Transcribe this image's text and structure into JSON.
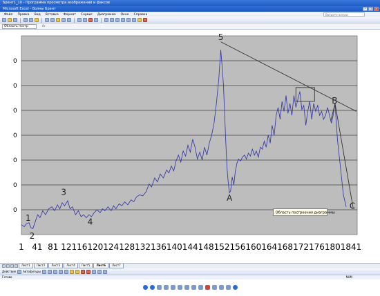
{
  "viewer": {
    "title": "Брент1_10 - Программа просмотра изображений и факсов"
  },
  "excel": {
    "title": "Microsoft Excel - Волны Брент"
  },
  "menu": [
    "Файл",
    "Правка",
    "Вид",
    "Вставка",
    "Формат",
    "Сервис",
    "Диаграмма",
    "Окно",
    "Справка"
  ],
  "help_placeholder": "Введите вопрос",
  "name_box": "Область постр",
  "fx_label": "fx",
  "sheet_tabs": [
    "Лист1",
    "Лист2",
    "Лист3",
    "Лист4",
    "Лист5",
    "Лист6",
    "Лист7"
  ],
  "active_tab": "Лист6",
  "drawbar": {
    "actions": "Действия",
    "autoshapes": "Автофигуры"
  },
  "status": {
    "ready": "Готово",
    "num": "NUM"
  },
  "tooltip": "Область построения диаграммы",
  "colors": {
    "series": "#3c3ca8",
    "plot_bg": "#bdbdbd",
    "title_bar": "#2f6fd8"
  },
  "chart_data": {
    "type": "line",
    "x_ticks": [
      "1",
      "41",
      "81",
      "121",
      "161",
      "201",
      "241",
      "281",
      "321",
      "361",
      "401",
      "441",
      "481",
      "521",
      "561",
      "601",
      "641",
      "681",
      "721",
      "761",
      "801",
      "841"
    ],
    "xlim": [
      1,
      850
    ],
    "grid": true,
    "wave_labels": [
      {
        "text": "1",
        "x": 18,
        "level": 0.07
      },
      {
        "text": "2",
        "x": 28,
        "level": -0.02
      },
      {
        "text": "3",
        "x": 108,
        "level": 0.2
      },
      {
        "text": "4",
        "x": 175,
        "level": 0.05
      },
      {
        "text": "5",
        "x": 505,
        "level": 0.98
      },
      {
        "text": "A",
        "x": 527,
        "level": 0.17
      },
      {
        "text": "B",
        "x": 793,
        "level": 0.66
      },
      {
        "text": "C",
        "x": 838,
        "level": 0.13
      }
    ],
    "series": [
      {
        "points": [
          [
            1,
            0.05
          ],
          [
            8,
            0.04
          ],
          [
            14,
            0.055
          ],
          [
            20,
            0.06
          ],
          [
            25,
            0.035
          ],
          [
            30,
            0.03
          ],
          [
            36,
            0.065
          ],
          [
            42,
            0.1
          ],
          [
            48,
            0.085
          ],
          [
            55,
            0.12
          ],
          [
            62,
            0.1
          ],
          [
            70,
            0.13
          ],
          [
            78,
            0.14
          ],
          [
            85,
            0.12
          ],
          [
            92,
            0.15
          ],
          [
            98,
            0.13
          ],
          [
            104,
            0.16
          ],
          [
            110,
            0.145
          ],
          [
            118,
            0.17
          ],
          [
            124,
            0.13
          ],
          [
            130,
            0.14
          ],
          [
            138,
            0.1
          ],
          [
            145,
            0.12
          ],
          [
            152,
            0.09
          ],
          [
            158,
            0.1
          ],
          [
            165,
            0.085
          ],
          [
            172,
            0.1
          ],
          [
            178,
            0.09
          ],
          [
            185,
            0.11
          ],
          [
            192,
            0.125
          ],
          [
            200,
            0.11
          ],
          [
            206,
            0.13
          ],
          [
            212,
            0.12
          ],
          [
            220,
            0.14
          ],
          [
            228,
            0.12
          ],
          [
            234,
            0.145
          ],
          [
            240,
            0.13
          ],
          [
            248,
            0.155
          ],
          [
            255,
            0.145
          ],
          [
            262,
            0.165
          ],
          [
            270,
            0.15
          ],
          [
            278,
            0.175
          ],
          [
            285,
            0.165
          ],
          [
            292,
            0.19
          ],
          [
            300,
            0.2
          ],
          [
            308,
            0.195
          ],
          [
            316,
            0.215
          ],
          [
            324,
            0.255
          ],
          [
            330,
            0.24
          ],
          [
            338,
            0.285
          ],
          [
            345,
            0.265
          ],
          [
            352,
            0.305
          ],
          [
            360,
            0.285
          ],
          [
            368,
            0.325
          ],
          [
            374,
            0.31
          ],
          [
            380,
            0.345
          ],
          [
            386,
            0.32
          ],
          [
            392,
            0.37
          ],
          [
            398,
            0.4
          ],
          [
            404,
            0.365
          ],
          [
            410,
            0.42
          ],
          [
            416,
            0.395
          ],
          [
            422,
            0.45
          ],
          [
            428,
            0.415
          ],
          [
            434,
            0.48
          ],
          [
            440,
            0.44
          ],
          [
            446,
            0.38
          ],
          [
            452,
            0.415
          ],
          [
            458,
            0.375
          ],
          [
            464,
            0.44
          ],
          [
            470,
            0.4
          ],
          [
            476,
            0.46
          ],
          [
            482,
            0.5
          ],
          [
            488,
            0.56
          ],
          [
            494,
            0.66
          ],
          [
            500,
            0.78
          ],
          [
            505,
            0.93
          ],
          [
            508,
            0.86
          ],
          [
            512,
            0.75
          ],
          [
            515,
            0.6
          ],
          [
            518,
            0.45
          ],
          [
            521,
            0.33
          ],
          [
            524,
            0.26
          ],
          [
            527,
            0.21
          ],
          [
            530,
            0.22
          ],
          [
            534,
            0.29
          ],
          [
            538,
            0.25
          ],
          [
            542,
            0.32
          ],
          [
            546,
            0.36
          ],
          [
            550,
            0.38
          ],
          [
            555,
            0.37
          ],
          [
            560,
            0.39
          ],
          [
            565,
            0.4
          ],
          [
            570,
            0.38
          ],
          [
            575,
            0.41
          ],
          [
            580,
            0.395
          ],
          [
            585,
            0.43
          ],
          [
            590,
            0.4
          ],
          [
            595,
            0.42
          ],
          [
            600,
            0.39
          ],
          [
            605,
            0.44
          ],
          [
            610,
            0.43
          ],
          [
            615,
            0.47
          ],
          [
            620,
            0.44
          ],
          [
            625,
            0.5
          ],
          [
            630,
            0.46
          ],
          [
            635,
            0.55
          ],
          [
            640,
            0.5
          ],
          [
            645,
            0.6
          ],
          [
            650,
            0.64
          ],
          [
            655,
            0.58
          ],
          [
            660,
            0.67
          ],
          [
            665,
            0.62
          ],
          [
            670,
            0.7
          ],
          [
            675,
            0.61
          ],
          [
            680,
            0.66
          ],
          [
            685,
            0.6
          ],
          [
            690,
            0.7
          ],
          [
            695,
            0.64
          ],
          [
            700,
            0.68
          ],
          [
            705,
            0.72
          ],
          [
            710,
            0.63
          ],
          [
            715,
            0.65
          ],
          [
            720,
            0.55
          ],
          [
            725,
            0.62
          ],
          [
            730,
            0.67
          ],
          [
            735,
            0.58
          ],
          [
            740,
            0.66
          ],
          [
            745,
            0.62
          ],
          [
            750,
            0.65
          ],
          [
            755,
            0.6
          ],
          [
            760,
            0.62
          ],
          [
            765,
            0.58
          ],
          [
            770,
            0.6
          ],
          [
            775,
            0.64
          ],
          [
            780,
            0.6
          ],
          [
            785,
            0.56
          ],
          [
            790,
            0.61
          ],
          [
            794,
            0.66
          ],
          [
            800,
            0.48
          ],
          [
            808,
            0.33
          ],
          [
            815,
            0.2
          ],
          [
            822,
            0.14
          ]
        ]
      }
    ],
    "trend_line": [
      [
        505,
        0.97
      ],
      [
        848,
        0.62
      ]
    ]
  }
}
